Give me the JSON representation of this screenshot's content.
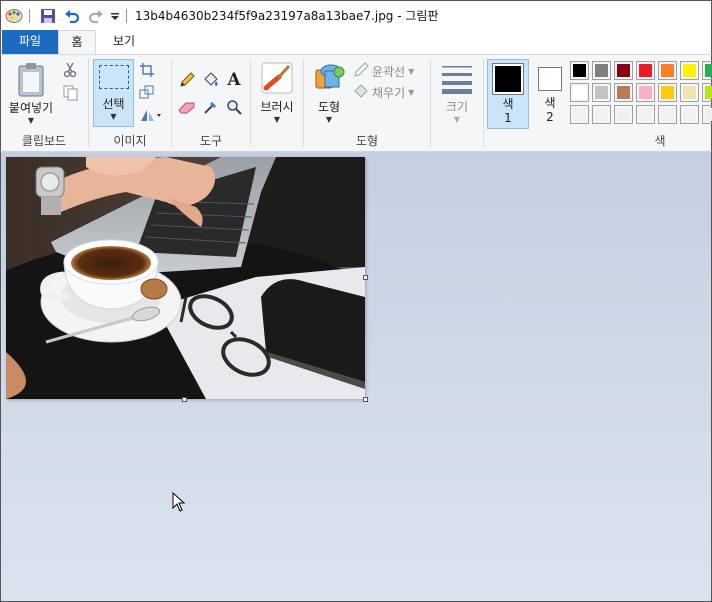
{
  "window": {
    "title": "13b4b4630b234f5f9a23197a8a13bae7.jpg - 그림판"
  },
  "quick_access": [
    "paint-app-icon",
    "save-icon",
    "undo-icon",
    "redo-icon",
    "customize-dropdown-icon"
  ],
  "tabs": {
    "file": "파일",
    "home": "홈",
    "view": "보기"
  },
  "ribbon": {
    "clipboard": {
      "label": "클립보드",
      "paste": "붙여넣기"
    },
    "image": {
      "label": "이미지",
      "select": "선택"
    },
    "tools": {
      "label": "도구"
    },
    "brushes": {
      "label": "브러시"
    },
    "shapes": {
      "label": "도형",
      "shapes_button": "도형",
      "outline": "윤곽선",
      "fill": "채우기"
    },
    "size": {
      "label": "크기"
    },
    "colors": {
      "label": "색",
      "color1": "색\n1",
      "color1_a": "색",
      "color1_b": "1",
      "color2_a": "색",
      "color2_b": "2",
      "color1_value": "#000000",
      "color2_value": "#ffffff",
      "palette_row1": [
        "#000000",
        "#7f7f7f",
        "#880015",
        "#ed1c24",
        "#ff7f27",
        "#fff200",
        "#22b14c"
      ],
      "palette_row2": [
        "#ffffff",
        "#c3c3c3",
        "#b97a57",
        "#ffaec9",
        "#ffc90e",
        "#efe4b0",
        "#b5e61d"
      ],
      "palette_row3": [
        "#f0f0f0",
        "#f0f0f0",
        "#f0f0f0",
        "#f0f0f0",
        "#f0f0f0",
        "#f0f0f0",
        "#f0f0f0"
      ]
    }
  },
  "colors": {
    "file_tab_bg": "#1c6bc1",
    "ribbon_bg": "#f5f6f7",
    "selected_btn_bg": "#cce4f7"
  }
}
